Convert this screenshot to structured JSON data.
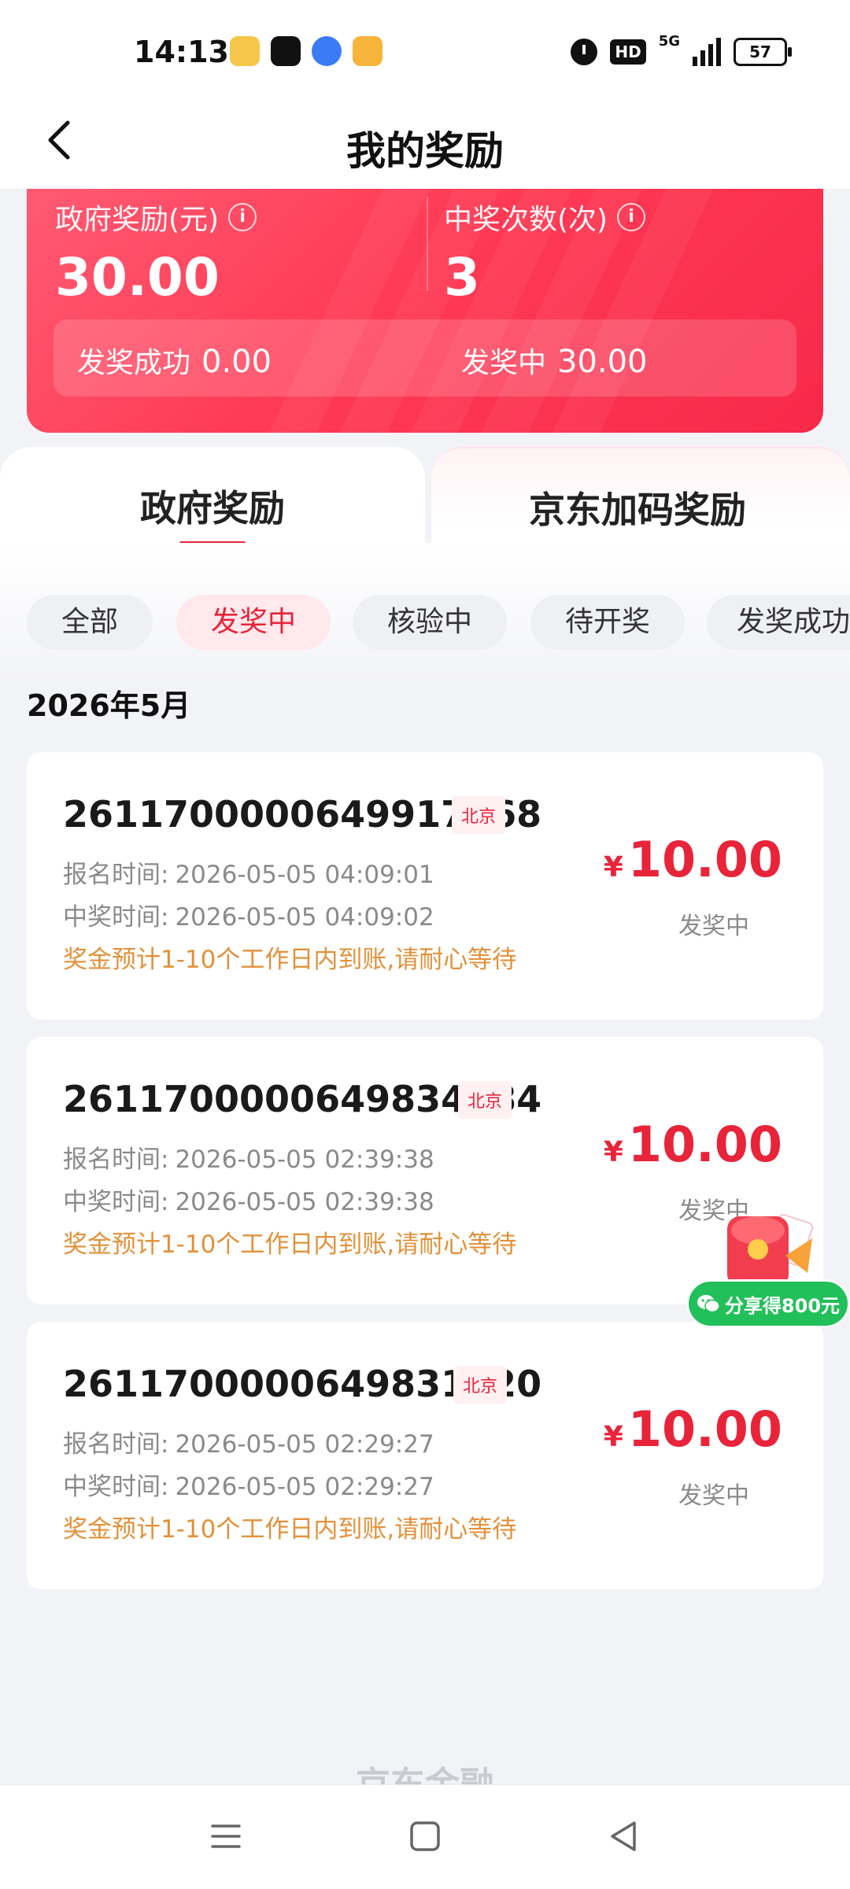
{
  "status_bar": {
    "time": "14:13",
    "hd": "HD",
    "network": "5G",
    "battery": "57",
    "app_icons": [
      "meituan-icon",
      "tiktok-icon",
      "browser-icon",
      "video-app-icon"
    ]
  },
  "header": {
    "title": "我的奖励"
  },
  "summary": {
    "gov_reward_label": "政府奖励(元)",
    "gov_reward_value": "30.00",
    "win_count_label": "中奖次数(次)",
    "win_count_value": "3",
    "success_label": "发奖成功",
    "success_value": "0.00",
    "pending_label": "发奖中",
    "pending_value": "30.00"
  },
  "tabs": [
    {
      "label": "政府奖励",
      "active": true
    },
    {
      "label": "京东加码奖励",
      "active": false
    }
  ],
  "filters": [
    {
      "label": "全部",
      "active": false
    },
    {
      "label": "发奖中",
      "active": true
    },
    {
      "label": "核验中",
      "active": false
    },
    {
      "label": "待开奖",
      "active": false
    },
    {
      "label": "发奖成功",
      "active": false
    }
  ],
  "month": "2026年5月",
  "records": [
    {
      "id": "2611700000649917368",
      "city": "北京",
      "signup_label": "报名时间:",
      "signup_time": "2026-05-05 04:09:01",
      "win_label": "中奖时间:",
      "win_time": "2026-05-05 04:09:02",
      "note": "奖金预计1-10个工作日内到账,请耐心等待",
      "currency": "¥",
      "amount": "10.00",
      "status": "发奖中"
    },
    {
      "id": "2611700000649834784",
      "city": "北京",
      "signup_label": "报名时间:",
      "signup_time": "2026-05-05 02:39:38",
      "win_label": "中奖时间:",
      "win_time": "2026-05-05 02:39:38",
      "note": "奖金预计1-10个工作日内到账,请耐心等待",
      "currency": "¥",
      "amount": "10.00",
      "status": "发奖中"
    },
    {
      "id": "2611700000649831020",
      "city": "北京",
      "signup_label": "报名时间:",
      "signup_time": "2026-05-05 02:29:27",
      "win_label": "中奖时间:",
      "win_time": "2026-05-05 02:29:27",
      "note": "奖金预计1-10个工作日内到账,请耐心等待",
      "currency": "¥",
      "amount": "10.00",
      "status": "发奖中"
    }
  ],
  "float_share": {
    "label": "分享得800元"
  },
  "footer": {
    "brand": "京东金融"
  },
  "colors": {
    "accent": "#e8243a",
    "note": "#e2913a",
    "share": "#22c05a"
  }
}
